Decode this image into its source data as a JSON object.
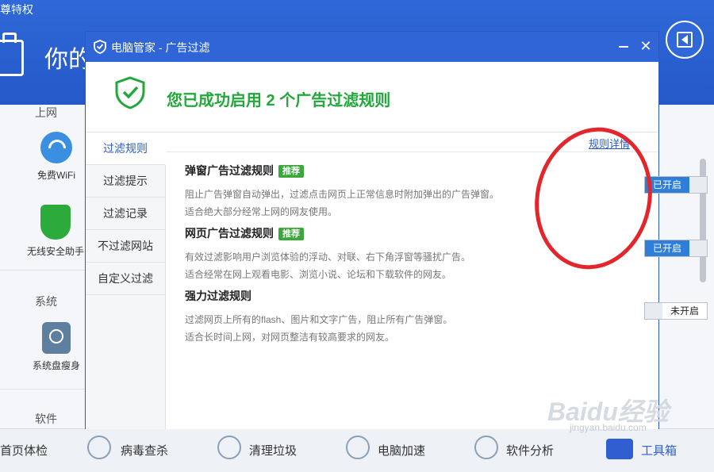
{
  "background": {
    "corner_text": "尊特权",
    "big_title": "你的",
    "sections": [
      "上网",
      "系统",
      "软件"
    ],
    "apps": [
      {
        "label": "免费WiFi",
        "icon": "wifi-icon"
      },
      {
        "label": "无线安全助手",
        "icon": "wifi-shield-icon"
      },
      {
        "label": "系统盘瘦身",
        "icon": "disk-icon"
      }
    ],
    "bottom_bar": [
      {
        "label": "首页体检",
        "icon": "home-check-icon"
      },
      {
        "label": "病毒查杀",
        "icon": "virus-scan-icon"
      },
      {
        "label": "清理垃圾",
        "icon": "broom-icon"
      },
      {
        "label": "电脑加速",
        "icon": "rocket-icon"
      },
      {
        "label": "软件分析",
        "icon": "software-icon"
      },
      {
        "label": "工具箱",
        "icon": "toolbox-icon"
      }
    ]
  },
  "dialog": {
    "title": "电脑管家 - 广告过滤",
    "banner_text": "您已成功启用 2 个广告过滤规则",
    "tabs": [
      "过滤规则",
      "过滤提示",
      "过滤记录",
      "不过滤网站",
      "自定义过滤"
    ],
    "active_tab": "过滤规则",
    "detail_link": "规则详情",
    "rules": [
      {
        "title": "弹窗广告过滤规则",
        "badge": "推荐",
        "desc1": "阻止广告弹窗自动弹出，过滤点击网页上正常信息时附加弹出的广告弹窗。",
        "desc2": "适合绝大部分经常上网的网友使用。",
        "toggle": "已开启",
        "enabled": true
      },
      {
        "title": "网页广告过滤规则",
        "badge": "推荐",
        "desc1": "有效过滤影响用户浏览体验的浮动、对联、右下角浮窗等骚扰广告。",
        "desc2": "适合经常在网上观看电影、浏览小说、论坛和下载软件的网友。",
        "toggle": "已开启",
        "enabled": true
      },
      {
        "title": "强力过滤规则",
        "badge": "",
        "desc1": "过滤网页上所有的flash、图片和文字广告，阻止所有广告弹窗。",
        "desc2": "适合长时间上网，对网页整洁有较高要求的网友。",
        "toggle": "未开启",
        "enabled": false
      }
    ]
  },
  "watermark": {
    "text": "Baidu经验",
    "sub": "jingyan.baidu.com"
  },
  "colors": {
    "titlebar": "#3065d8",
    "banner_green": "#22a83a",
    "toggle_on": "#2f7fd8",
    "badge": "#3aa83a",
    "annotation": "#e2262b"
  }
}
